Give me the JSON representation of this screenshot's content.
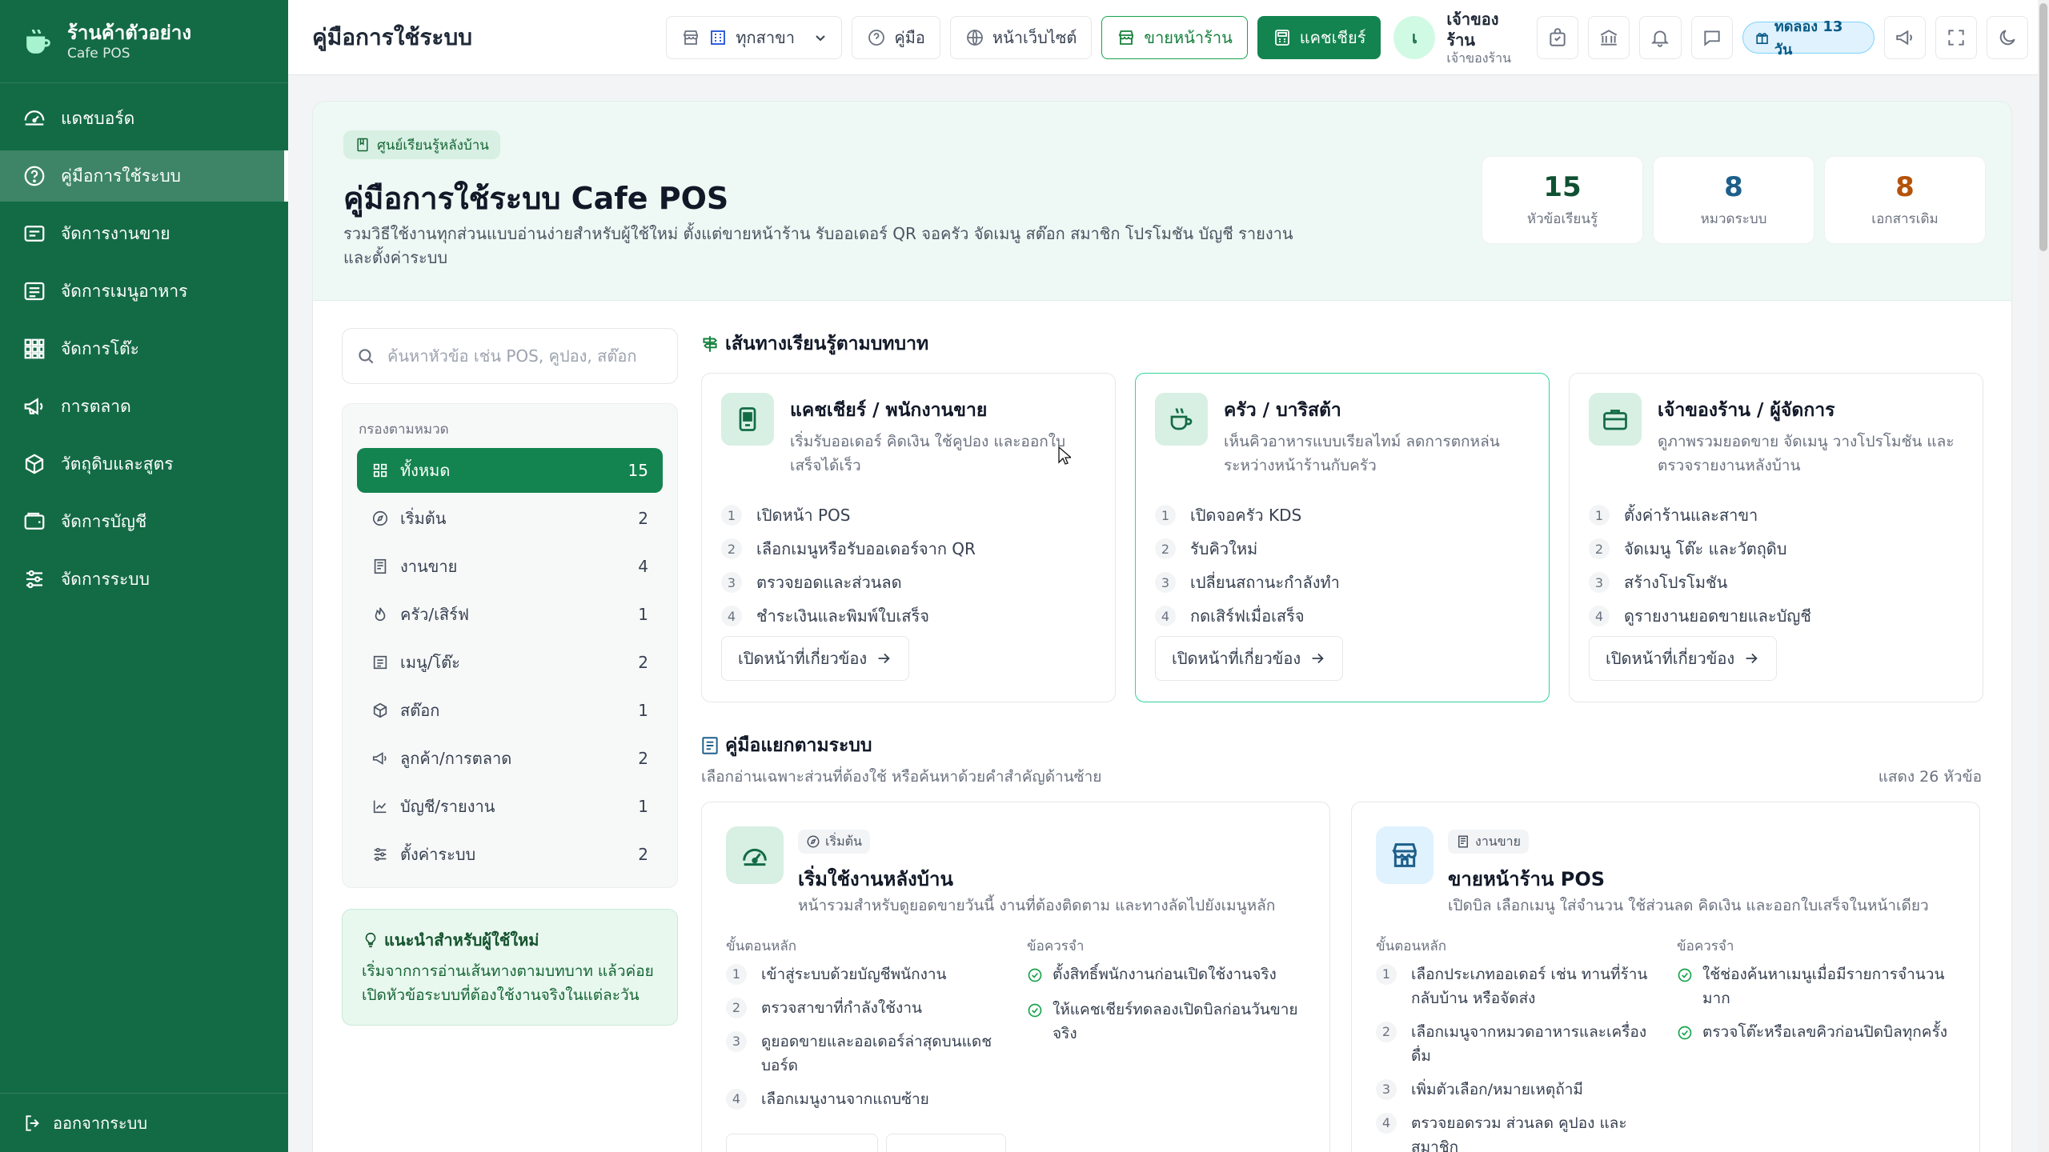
{
  "sidebar": {
    "brand_name": "ร้านค้าตัวอย่าง",
    "brand_sub": "Cafe POS",
    "items": [
      {
        "label": "แดชบอร์ด",
        "icon": "dashboard-icon"
      },
      {
        "label": "คู่มือการใช้ระบบ",
        "icon": "help-circle-icon",
        "active": true
      },
      {
        "label": "จัดการงานขาย",
        "icon": "receipt-icon"
      },
      {
        "label": "จัดการเมนูอาหาร",
        "icon": "menu-book-icon"
      },
      {
        "label": "จัดการโต๊ะ",
        "icon": "table-grid-icon"
      },
      {
        "label": "การตลาด",
        "icon": "megaphone-icon"
      },
      {
        "label": "วัตถุดิบและสูตร",
        "icon": "box-icon"
      },
      {
        "label": "จัดการบัญชี",
        "icon": "wallet-icon"
      },
      {
        "label": "จัดการระบบ",
        "icon": "sliders-icon"
      }
    ],
    "logout": "ออกจากระบบ"
  },
  "topbar": {
    "title": "คู่มือการใช้ระบบ",
    "branch_select": "ทุกสาขา",
    "guide": "คู่มือ",
    "website": "หน้าเว็บไซต์",
    "storefront": "ขายหน้าร้าน",
    "cashier": "แคชเชียร์",
    "user_initial": "เ",
    "user_name": "เจ้าของร้าน",
    "user_role": "เจ้าของร้าน",
    "trial": "ทดลอง 13 วัน"
  },
  "hero": {
    "chip": "ศูนย์เรียนรู้หลังบ้าน",
    "title": "คู่มือการใช้ระบบ Cafe POS",
    "desc": "รวมวิธีใช้งานทุกส่วนแบบอ่านง่ายสำหรับผู้ใช้ใหม่ ตั้งแต่ขายหน้าร้าน รับออเดอร์ QR จอครัว จัดเมนู สต๊อก สมาชิก โปรโมชัน บัญชี รายงาน และตั้งค่าระบบ",
    "stats": [
      {
        "num": "15",
        "label": "หัวข้อเรียนรู้",
        "color": "#0f5132"
      },
      {
        "num": "8",
        "label": "หมวดระบบ",
        "color": "#1d5f8a"
      },
      {
        "num": "8",
        "label": "เอกสารเดิม",
        "color": "#b45309"
      }
    ]
  },
  "search": {
    "placeholder": "ค้นหาหัวข้อ เช่น POS, คูปอง, สต๊อก"
  },
  "filters": {
    "title": "กรองตามหมวด",
    "items": [
      {
        "label": "ทั้งหมด",
        "count": "15",
        "icon": "grid-icon"
      },
      {
        "label": "เริ่มต้น",
        "count": "2",
        "icon": "compass-icon"
      },
      {
        "label": "งานขาย",
        "count": "4",
        "icon": "receipt-icon"
      },
      {
        "label": "ครัว/เสิร์ฟ",
        "count": "1",
        "icon": "flame-icon"
      },
      {
        "label": "เมนู/โต๊ะ",
        "count": "2",
        "icon": "list-icon"
      },
      {
        "label": "สต๊อก",
        "count": "1",
        "icon": "box-icon"
      },
      {
        "label": "ลูกค้า/การตลาด",
        "count": "2",
        "icon": "megaphone-icon"
      },
      {
        "label": "บัญชี/รายงาน",
        "count": "1",
        "icon": "chart-line-icon"
      },
      {
        "label": "ตั้งค่าระบบ",
        "count": "2",
        "icon": "sliders-icon"
      }
    ]
  },
  "tip": {
    "title": "แนะนำสำหรับผู้ใช้ใหม่",
    "body": "เริ่มจากการอ่านเส้นทางตามบทบาท แล้วค่อยเปิดหัวข้อระบบที่ต้องใช้งานจริงในแต่ละวัน"
  },
  "roles_section": {
    "title": "เส้นทางเรียนรู้ตามบทบาท"
  },
  "roles": [
    {
      "title": "แคชเชียร์ / พนักงานขาย",
      "desc": "เริ่มรับออเดอร์ คิดเงิน ใช้คูปอง และออกใบเสร็จได้เร็ว",
      "icon": "mobile-icon",
      "steps": [
        "เปิดหน้า POS",
        "เลือกเมนูหรือรับออเดอร์จาก QR",
        "ตรวจยอดและส่วนลด",
        "ชำระเงินและพิมพ์ใบเสร็จ"
      ],
      "button": "เปิดหน้าที่เกี่ยวข้อง"
    },
    {
      "title": "ครัว / บาริสต้า",
      "desc": "เห็นคิวอาหารแบบเรียลไทม์ ลดการตกหล่นระหว่างหน้าร้านกับครัว",
      "icon": "coffee-icon",
      "steps": [
        "เปิดจอครัว KDS",
        "รับคิวใหม่",
        "เปลี่ยนสถานะกำลังทำ",
        "กดเสิร์ฟเมื่อเสร็จ"
      ],
      "button": "เปิดหน้าที่เกี่ยวข้อง"
    },
    {
      "title": "เจ้าของร้าน / ผู้จัดการ",
      "desc": "ดูภาพรวมยอดขาย จัดเมนู วางโปรโมชัน และตรวจรายงานหลังบ้าน",
      "icon": "briefcase-icon",
      "steps": [
        "ตั้งค่าร้านและสาขา",
        "จัดเมนู โต๊ะ และวัตถุดิบ",
        "สร้างโปรโมชัน",
        "ดูรายงานยอดขายและบัญชี"
      ],
      "button": "เปิดหน้าที่เกี่ยวข้อง"
    }
  ],
  "modules_section": {
    "title": "คู่มือแยกตามระบบ",
    "sub": "เลือกอ่านเฉพาะส่วนที่ต้องใช้ หรือค้นหาด้วยคำสำคัญด้านซ้าย",
    "count": "แสดง 26 หัวข้อ"
  },
  "modules": [
    {
      "tag": "เริ่มต้น",
      "title": "เริ่มใช้งานหลังบ้าน",
      "desc": "หน้ารวมสำหรับดูยอดขายวันนี้ งานที่ต้องติดตาม และทางลัดไปยังเมนูหลัก",
      "steps_h": "ขั้นตอนหลัก",
      "notes_h": "ข้อควรจำ",
      "steps": [
        "เข้าสู่ระบบด้วยบัญชีพนักงาน",
        "ตรวจสาขาที่กำลังใช้งาน",
        "ดูยอดขายและออเดอร์ล่าสุดบนแดชบอร์ด",
        "เลือกเมนูงานจากแถบซ้าย"
      ],
      "notes": [
        "ตั้งสิทธิ์พนักงานก่อนเปิดใช้งานจริง",
        "ให้แคชเชียร์ทดลองเปิดบิลก่อนวันขายจริง"
      ]
    },
    {
      "tag": "งานขาย",
      "title": "ขายหน้าร้าน POS",
      "desc": "เปิดบิล เลือกเมนู ใส่จำนวน ใช้ส่วนลด คิดเงิน และออกใบเสร็จในหน้าเดียว",
      "steps_h": "ขั้นตอนหลัก",
      "notes_h": "ข้อควรจำ",
      "steps": [
        "เลือกประเภทออเดอร์ เช่น ทานที่ร้าน กลับบ้าน หรือจัดส่ง",
        "เลือกเมนูจากหมวดอาหารและเครื่องดื่ม",
        "เพิ่มตัวเลือก/หมายเหตุถ้ามี",
        "ตรวจยอดรวม ส่วนลด คูปอง และสมาชิก"
      ],
      "notes": [
        "ใช้ช่องค้นหาเมนูเมื่อมีรายการจำนวนมาก",
        "ตรวจโต๊ะหรือเลขคิวก่อนปิดบิลทุกครั้ง"
      ]
    }
  ]
}
